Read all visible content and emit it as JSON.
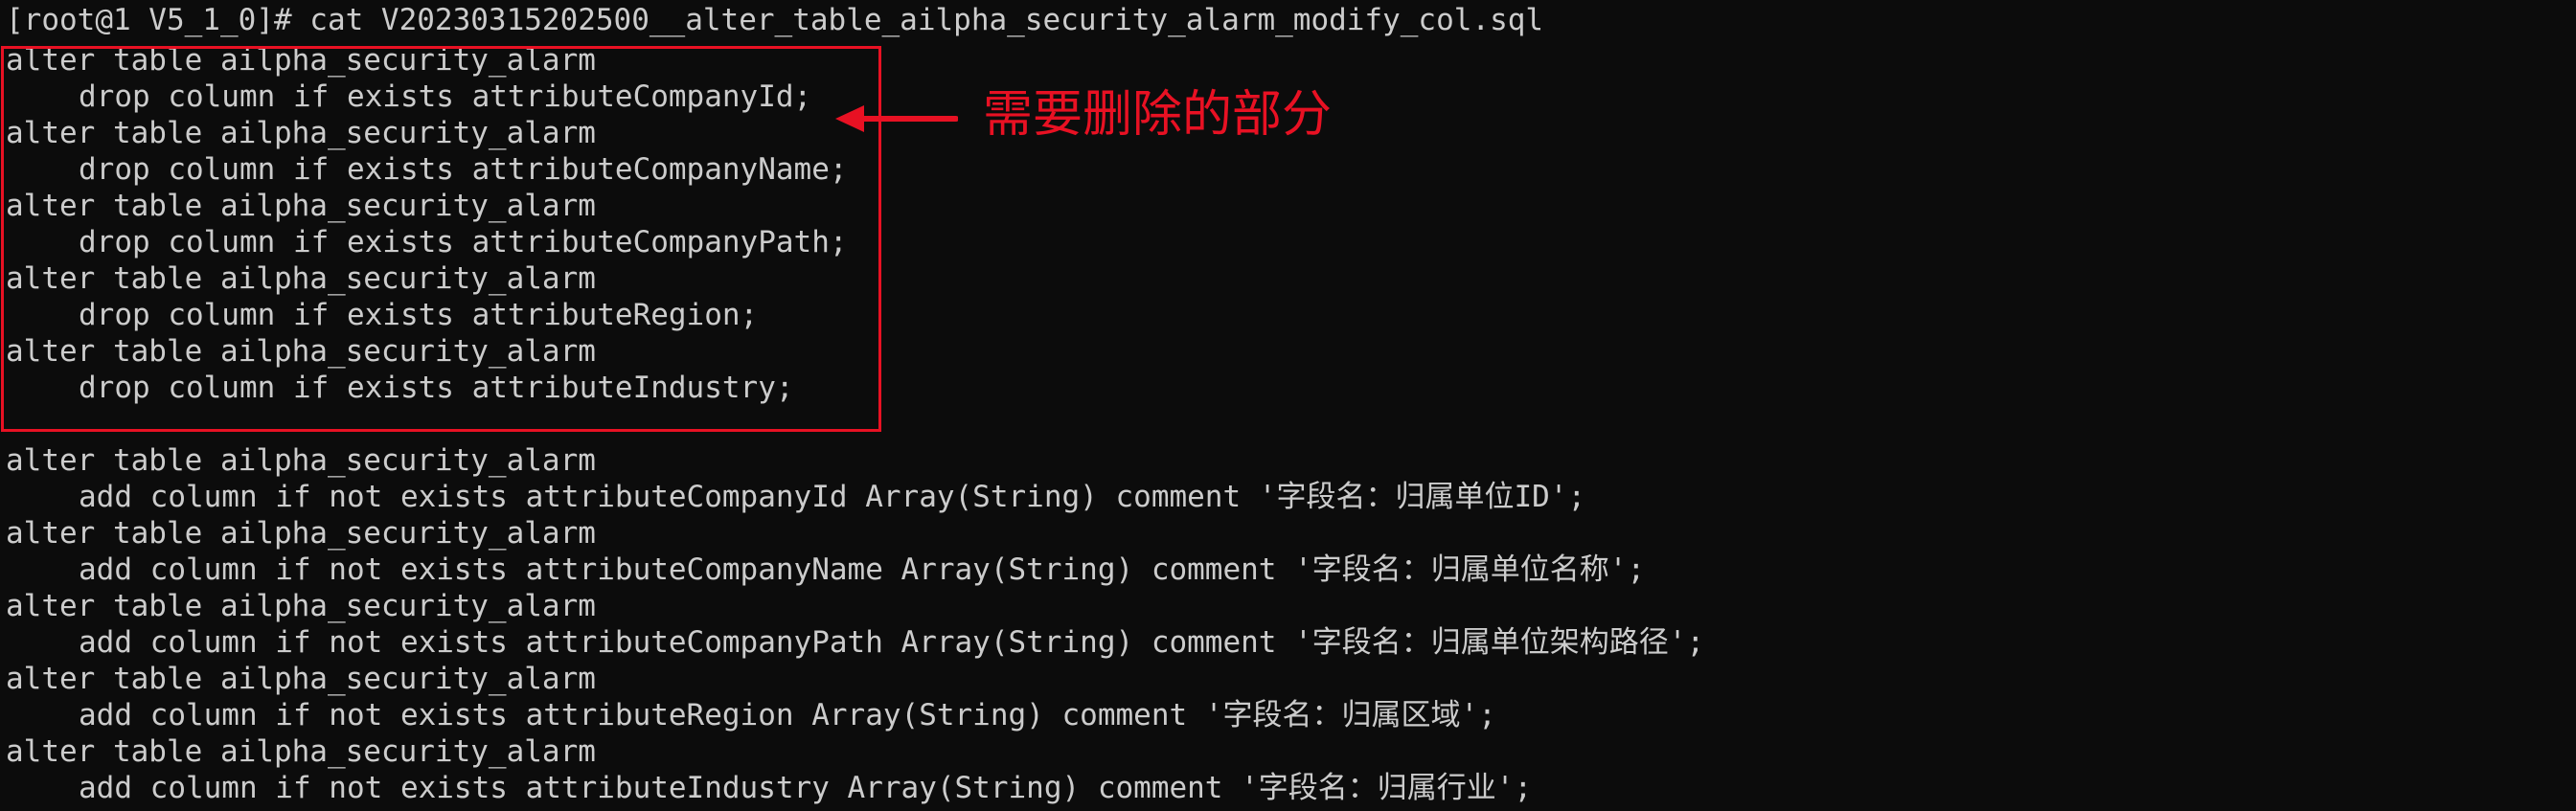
{
  "terminal": {
    "top_partial": "------------------------------------------------------------------------------------------------------------------------------------------------",
    "prompt_line": "[root@1 V5_1_0]# cat V20230315202500__alter_table_ailpha_security_alarm_modify_col.sql",
    "drop_lines": [
      "alter table ailpha_security_alarm",
      "drop column if exists attributeCompanyId;",
      "alter table ailpha_security_alarm",
      "drop column if exists attributeCompanyName;",
      "alter table ailpha_security_alarm",
      "drop column if exists attributeCompanyPath;",
      "alter table ailpha_security_alarm",
      "drop column if exists attributeRegion;",
      "alter table ailpha_security_alarm",
      "drop column if exists attributeIndustry;"
    ],
    "add_lines": [
      "alter table ailpha_security_alarm",
      "add column if not exists attributeCompanyId Array(String) comment '字段名：归属单位ID';",
      "alter table ailpha_security_alarm",
      "add column if not exists attributeCompanyName Array(String) comment '字段名：归属单位名称';",
      "alter table ailpha_security_alarm",
      "add column if not exists attributeCompanyPath Array(String) comment '字段名：归属单位架构路径';",
      "alter table ailpha_security_alarm",
      "add column if not exists attributeRegion Array(String) comment '字段名：归属区域';",
      "alter table ailpha_security_alarm",
      "add column if not exists attributeIndustry Array(String) comment '字段名：归属行业';"
    ]
  },
  "annotation": {
    "text": "需要删除的部分",
    "color": "#e81123"
  }
}
